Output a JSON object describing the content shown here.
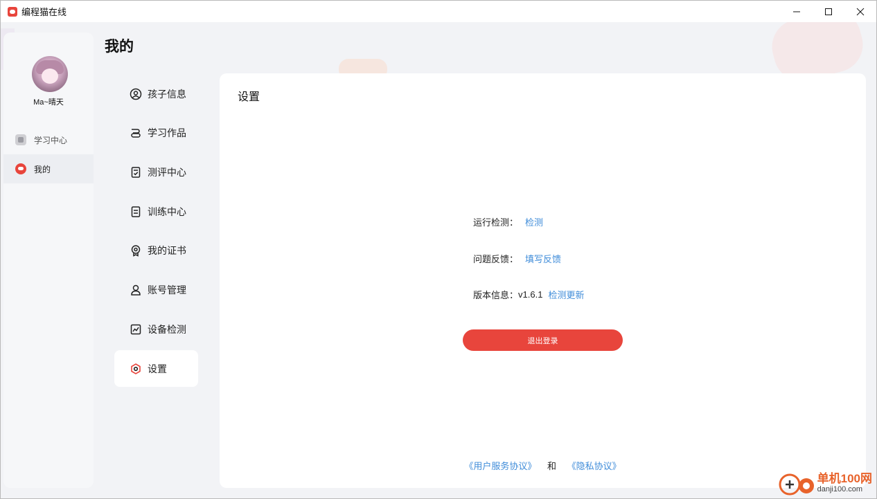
{
  "window": {
    "title": "编程猫在线",
    "controls": [
      "minimize-icon",
      "maximize-icon",
      "close-icon"
    ]
  },
  "sidebar": {
    "username": "Ma~晴天",
    "items": [
      {
        "label": "学习中心",
        "icon": "study-center-icon",
        "active": false
      },
      {
        "label": "我的",
        "icon": "cat-logo-icon",
        "active": true
      }
    ]
  },
  "page": {
    "title": "我的"
  },
  "submenu": {
    "items": [
      {
        "label": "孩子信息",
        "icon": "user-circle-icon"
      },
      {
        "label": "学习作品",
        "icon": "layers-icon"
      },
      {
        "label": "测评中心",
        "icon": "clipboard-check-icon"
      },
      {
        "label": "训练中心",
        "icon": "document-icon"
      },
      {
        "label": "我的证书",
        "icon": "award-icon"
      },
      {
        "label": "账号管理",
        "icon": "person-icon"
      },
      {
        "label": "设备检测",
        "icon": "chart-line-icon"
      },
      {
        "label": "设置",
        "icon": "settings-icon",
        "active": true
      }
    ]
  },
  "settings": {
    "title": "设置",
    "run_check_label": "运行检测：",
    "run_check_link": "检测",
    "feedback_label": "问题反馈：",
    "feedback_link": "填写反馈",
    "version_label": "版本信息：",
    "version_value": "v1.6.1",
    "version_link": "检测更新",
    "logout_label": "退出登录",
    "user_agreement": "《用户服务协议》",
    "and_text": "和",
    "privacy_agreement": "《隐私协议》"
  },
  "watermark": {
    "cn": "单机100网",
    "en": "danji100.com"
  },
  "colors": {
    "accent": "#e8453c",
    "link": "#3f8cd9",
    "background": "#f2f3f6"
  }
}
